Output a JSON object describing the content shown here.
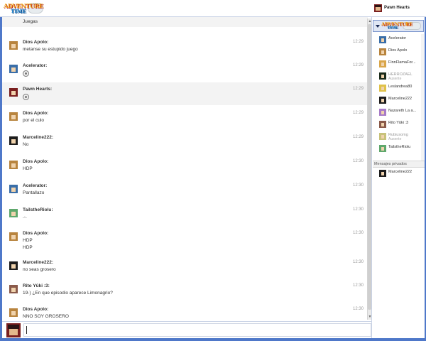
{
  "app": {
    "logo_text": "ADVENTURE",
    "logo_sub": "TIME"
  },
  "header": {
    "current_user": "Pawn Hearts"
  },
  "messages": [
    {
      "author": "",
      "lines": [
        "Juegas"
      ],
      "time": "",
      "highlight": true,
      "avatar_color": "#9aa"
    },
    {
      "author": "Dios Apolo:",
      "lines": [
        "metanse su estupido juego"
      ],
      "time": "12:29",
      "highlight": false,
      "avatar_color": "#b8843e"
    },
    {
      "author": "Acelerator:",
      "lines": [],
      "emote": "emoticon-icon",
      "time": "12:29",
      "highlight": false,
      "avatar_color": "#3a6ea8"
    },
    {
      "author": "Pawn Hearts:",
      "lines": [],
      "emote": "emoticon-icon",
      "time": "12:29",
      "highlight": true,
      "avatar_color": "#7a1f1f"
    },
    {
      "author": "Dios Apolo:",
      "lines": [
        "por el culo"
      ],
      "time": "12:29",
      "highlight": false,
      "avatar_color": "#b8843e"
    },
    {
      "author": "Marceline222:",
      "lines": [
        "No"
      ],
      "time": "12:29",
      "highlight": false,
      "avatar_color": "#1d1d1d"
    },
    {
      "author": "Dios Apolo:",
      "lines": [
        "HDP"
      ],
      "time": "12:30",
      "highlight": false,
      "avatar_color": "#b8843e"
    },
    {
      "author": "Acelerator:",
      "lines": [
        "Pantallazo"
      ],
      "time": "12:30",
      "highlight": false,
      "avatar_color": "#3a6ea8"
    },
    {
      "author": "TailstheRiolu:",
      "lines": [
        ".-."
      ],
      "time": "12:30",
      "highlight": false,
      "avatar_color": "#5fa86c"
    },
    {
      "author": "Dios Apolo:",
      "lines": [
        "HDP",
        "HDP"
      ],
      "time": "12:30",
      "highlight": false,
      "avatar_color": "#b8843e"
    },
    {
      "author": "Marceline222:",
      "lines": [
        "no seas grosero"
      ],
      "time": "12:30",
      "highlight": false,
      "avatar_color": "#1d1d1d"
    },
    {
      "author": "Rito Yûki :3:",
      "lines": [
        "19-) ¿En que episodio aparece Limonagrio?"
      ],
      "time": "12:30",
      "highlight": false,
      "avatar_color": "#8a5a4a"
    },
    {
      "author": "Dios Apolo:",
      "lines": [
        "NNO SOY GROSERO"
      ],
      "time": "12:30",
      "highlight": false,
      "avatar_color": "#b8843e"
    }
  ],
  "sidebar": {
    "users": [
      {
        "name": "Acelerator",
        "status": "",
        "away": false,
        "avatar_color": "#3a6ea8"
      },
      {
        "name": "Dios Apolo",
        "status": "",
        "away": false,
        "avatar_color": "#b8843e"
      },
      {
        "name": "FinnFlamaFor...",
        "status": "",
        "away": false,
        "avatar_color": "#d9a64a"
      },
      {
        "name": "HERROZAEL",
        "status": "Ausente",
        "away": true,
        "avatar_color": "#1b2b1b"
      },
      {
        "name": "Leslandrea80",
        "status": "",
        "away": false,
        "avatar_color": "#e0c24a"
      },
      {
        "name": "Marceline222",
        "status": "",
        "away": false,
        "avatar_color": "#1d1d1d"
      },
      {
        "name": "Nazareth La a...",
        "status": "",
        "away": false,
        "avatar_color": "#a77bc8"
      },
      {
        "name": "Rito Yûki :3",
        "status": "",
        "away": false,
        "avatar_color": "#8a5a4a"
      },
      {
        "name": "Rubiusomg",
        "status": "Ausente",
        "away": true,
        "avatar_color": "#c8c27a"
      },
      {
        "name": "TailstheRiolu",
        "status": "",
        "away": false,
        "avatar_color": "#5fa86c"
      }
    ],
    "private_title": "Mensajes privados",
    "private_users": [
      {
        "name": "Marceline222",
        "avatar_color": "#1d1d1d"
      }
    ]
  },
  "composer": {
    "value": "",
    "avatar_color": "#7a1f1f"
  }
}
